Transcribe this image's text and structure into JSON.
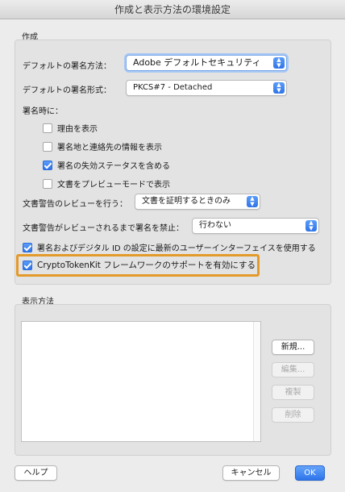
{
  "window": {
    "title": "作成と表示方法の環境設定"
  },
  "creation": {
    "section_label": "作成",
    "signing_method": {
      "label": "デフォルトの署名方法：",
      "value": "Adobe デフォルトセキュリティ"
    },
    "signing_format": {
      "label": "デフォルトの署名形式：",
      "value": "PKCS#7 - Detached"
    },
    "when_signing_label": "署名時に：",
    "options": [
      {
        "label": "理由を表示",
        "checked": false
      },
      {
        "label": "署名地と連絡先の情報を表示",
        "checked": false
      },
      {
        "label": "署名の失効ステータスを含める",
        "checked": true
      },
      {
        "label": "文書をプレビューモードで表示",
        "checked": false
      }
    ],
    "review_warnings": {
      "label": "文書警告のレビューを行う：",
      "value": "文書を証明するときのみ"
    },
    "prevent_signing": {
      "label": "文書警告がレビューされるまで署名を禁止：",
      "value": "行わない"
    },
    "latest_ui": {
      "label": "署名およびデジタル ID の設定に最新のユーザーインターフェイスを使用する",
      "checked": true
    },
    "cryptotokenkit": {
      "label": "CryptoTokenKit フレームワークのサポートを有効にする",
      "checked": true
    }
  },
  "appearance": {
    "section_label": "表示方法",
    "items": [],
    "buttons": {
      "new": "新規...",
      "edit": "編集...",
      "duplicate": "複製",
      "delete": "削除"
    }
  },
  "footer": {
    "help": "ヘルプ",
    "cancel": "キャンセル",
    "ok": "OK"
  },
  "colors": {
    "accent": "#2f74e8",
    "highlight_border": "#e49a2a"
  }
}
